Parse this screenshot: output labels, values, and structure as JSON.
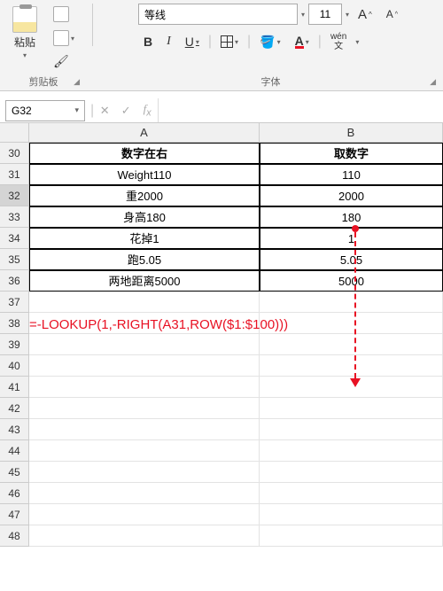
{
  "ribbon": {
    "clipboard": {
      "paste_label": "粘贴",
      "group_label": "剪贴板"
    },
    "font": {
      "name": "等线",
      "size": "11",
      "btn_bold": "B",
      "btn_italic": "I",
      "btn_underline": "U",
      "btn_font_color_glyph": "A",
      "btn_bigger_glyph": "A^",
      "btn_smaller_glyph": "A^",
      "btn_wen_top": "wén",
      "btn_wen_bottom": "文",
      "group_label": "字体"
    }
  },
  "name_box": "G32",
  "columns": [
    "A",
    "B"
  ],
  "row_start": 30,
  "row_end": 48,
  "selected_row": 32,
  "table": {
    "header_a": "数字在右",
    "header_b": "取数字",
    "rows": [
      {
        "a": "Weight110",
        "b": "110"
      },
      {
        "a": "重2000",
        "b": "2000"
      },
      {
        "a": "身高180",
        "b": "180"
      },
      {
        "a": "花掉1",
        "b": "1"
      },
      {
        "a": "跑5.05",
        "b": "5.05"
      },
      {
        "a": "两地距离5000",
        "b": "5000"
      }
    ]
  },
  "formula": "=-LOOKUP(1,-RIGHT(A31,ROW($1:$100)))"
}
